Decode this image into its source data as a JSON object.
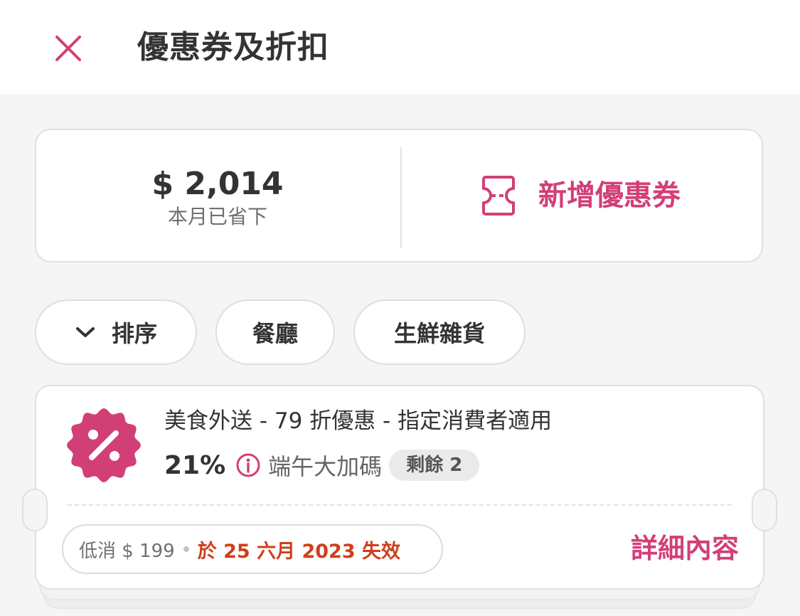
{
  "colors": {
    "accent": "#d23f77",
    "expiry": "#d03e1c",
    "background": "#f5f5f5"
  },
  "header": {
    "close_icon": "close-icon",
    "title": "優惠券及折扣"
  },
  "summary": {
    "amount": "$ 2,014",
    "label": "本月已省下",
    "add_voucher_icon": "ticket-icon",
    "add_voucher_label": "新增優惠券"
  },
  "filters": {
    "sort_icon": "chevron-down-icon",
    "sort_label": "排序",
    "chips": [
      "餐廳",
      "生鮮雜貨"
    ]
  },
  "voucher": {
    "icon": "percent-badge-icon",
    "title": "美食外送 - 79 折優惠 - 指定消費者適用",
    "discount": "21%",
    "info_icon": "info-icon",
    "campaign": "端午大加碼",
    "remaining": "剩餘 2",
    "min_spend": "低消 $ 199",
    "expiry": "於 25 六月 2023 失效",
    "details_label": "詳細內容"
  }
}
